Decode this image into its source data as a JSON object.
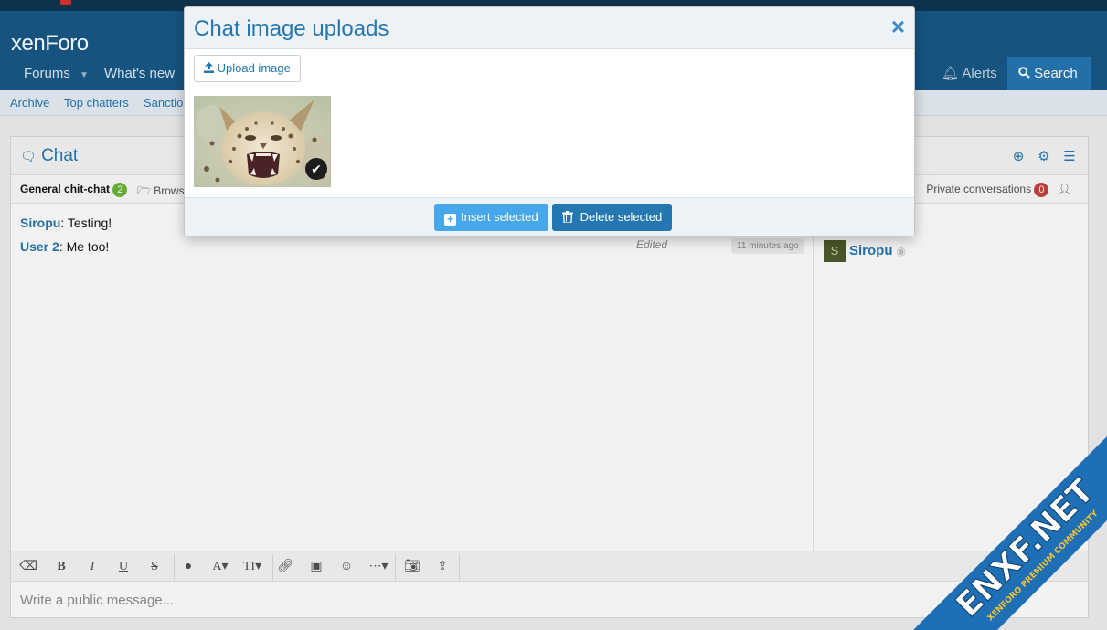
{
  "header": {
    "logo_prefix": "xen",
    "logo_suffix": "Foro",
    "nav": [
      {
        "label": "Forums",
        "has_dropdown": true
      },
      {
        "label": "What's new",
        "has_dropdown": true
      }
    ],
    "nav_right": {
      "inbox_partial": "x",
      "alerts": "Alerts",
      "search": "Search"
    }
  },
  "subnav": [
    "Archive",
    "Top chatters",
    "Sanctio"
  ],
  "chat": {
    "title": "Chat",
    "tab_general": "General chit-chat",
    "tab_general_count": "2",
    "tab_browse": "Brows",
    "private_label": "Private conversations",
    "private_count": "0",
    "messages": [
      {
        "author": "Siropu",
        "text": " Testing!"
      },
      {
        "author": "User 2",
        "text": " Me too!"
      }
    ],
    "edited_label": "Edited",
    "time_label": "11 minutes ago",
    "users": [
      {
        "name": "Siropu",
        "avatar_letter": "S"
      }
    ],
    "composer_placeholder": "Write a public message..."
  },
  "modal": {
    "title": "Chat image uploads",
    "close_glyph": "×",
    "upload_label": "Upload image",
    "insert_label": "Insert selected",
    "delete_label": "Delete selected"
  },
  "watermark": {
    "text": "ENXF.NET",
    "tagline": "XENFORO PREMIUM COMMUNITY"
  },
  "colors": {
    "accent": "#2577b1",
    "header": "#185886",
    "insert": "#47a7eb",
    "badge_green": "#6eb63c",
    "badge_red": "#c84040",
    "watermark": "#1e6fb5"
  }
}
